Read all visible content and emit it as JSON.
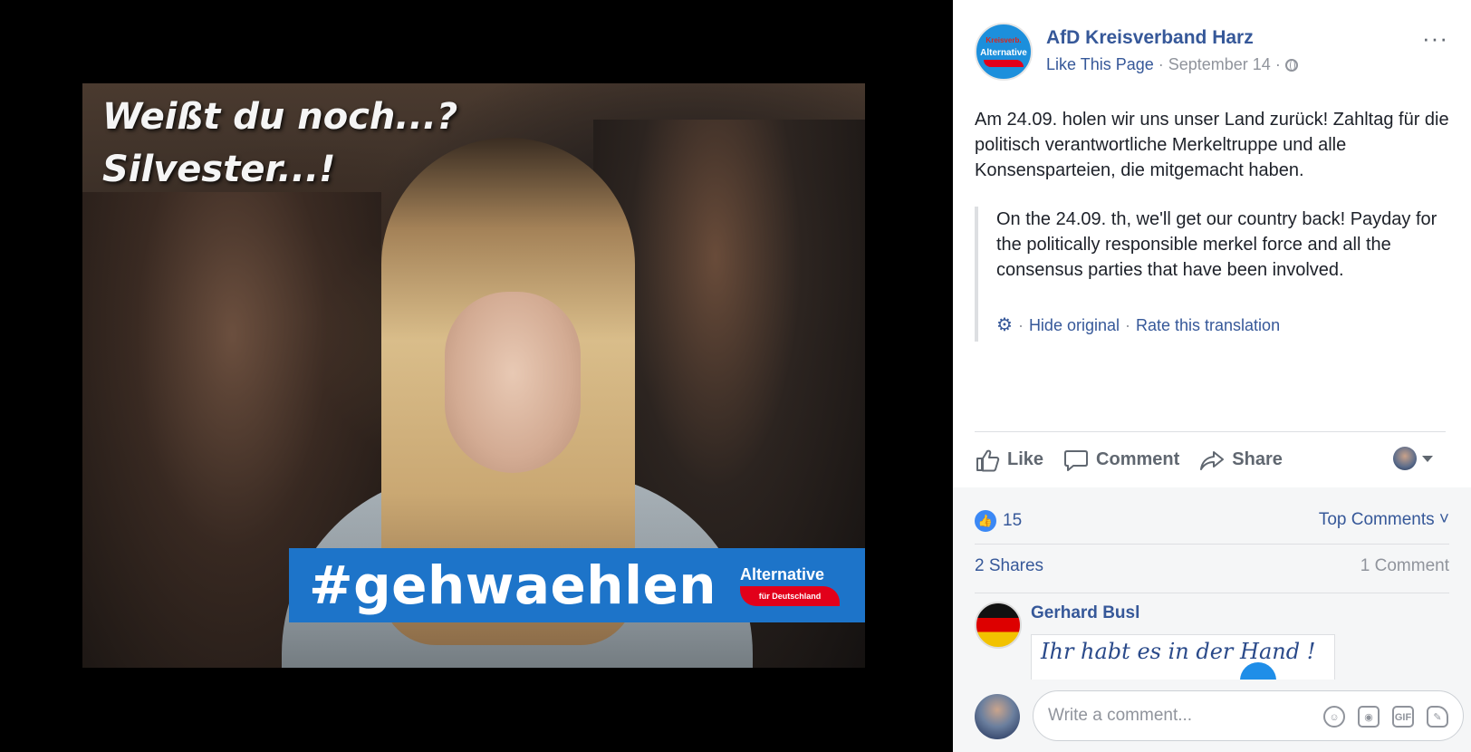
{
  "photo": {
    "overlay_text": "Weißt du noch...?\nSilvester...!",
    "hashtag": "#gehwaehlen",
    "logo_word": "Alternative",
    "logo_sub": "für Deutschland"
  },
  "post": {
    "page_name": "AfD Kreisverband Harz",
    "like_page": "Like This Page",
    "sep": "·",
    "date": "September 14",
    "avatar_top": "Kreisverb.",
    "avatar_word": "Alternative",
    "text": "Am 24.09. holen wir uns unser Land zurück! Zahltag für die politisch verantwortliche Merkeltruppe und alle Konsensparteien, die mitgemacht haben.",
    "translation": "On the 24.09. th, we'll get our country back! Payday for the politically responsible merkel force and all the consensus parties that have been involved.",
    "hide_original": "Hide original",
    "rate_translation": "Rate this translation"
  },
  "actions": {
    "like": "Like",
    "comment": "Comment",
    "share": "Share"
  },
  "stats": {
    "reactions": "15",
    "top_comments": "Top Comments ˅",
    "shares": "2 Shares",
    "comments": "1 Comment"
  },
  "comment": {
    "author": "Gerhard Busl",
    "image_text": "Ihr habt es in der Hand !"
  },
  "composer": {
    "placeholder": "Write a comment..."
  }
}
